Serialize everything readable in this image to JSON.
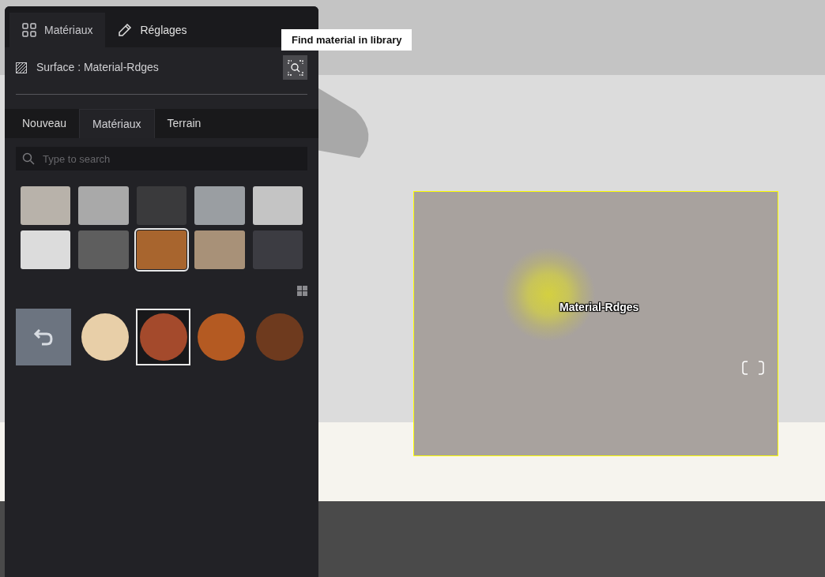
{
  "panel_tabs": [
    {
      "label": "Matériaux",
      "kind": "grid",
      "selected": true
    },
    {
      "label": "Réglages",
      "kind": "pencil",
      "selected": false
    }
  ],
  "tooltip": "Find material in library",
  "surface_label": "Surface : Material-Rdges",
  "sub_tabs": [
    {
      "label": "Nouveau",
      "selected": false
    },
    {
      "label": "Matériaux",
      "selected": true
    },
    {
      "label": "Terrain",
      "selected": false
    }
  ],
  "search": {
    "placeholder": "Type to search"
  },
  "materials": [
    {
      "color": "#b8b2aa",
      "selected": false
    },
    {
      "color": "#a9a9a9",
      "selected": false
    },
    {
      "color": "#3a3a3c",
      "selected": false
    },
    {
      "color": "#9a9ea2",
      "selected": false
    },
    {
      "color": "#c4c4c4",
      "selected": false
    },
    {
      "color": "#dcdcdc",
      "selected": false
    },
    {
      "color": "#5e5e5e",
      "selected": false
    },
    {
      "color": "#a8652e",
      "selected": true
    },
    {
      "color": "#a89178",
      "selected": false
    },
    {
      "color": "#3c3c42",
      "selected": false
    }
  ],
  "variants": [
    {
      "color": "#e8cfa8",
      "selected": false
    },
    {
      "color": "#a44a2c",
      "selected": true
    },
    {
      "color": "#b45a22",
      "selected": false
    },
    {
      "color": "#6e3a1e",
      "selected": false
    }
  ],
  "viewport_label": "Material-Rdges"
}
